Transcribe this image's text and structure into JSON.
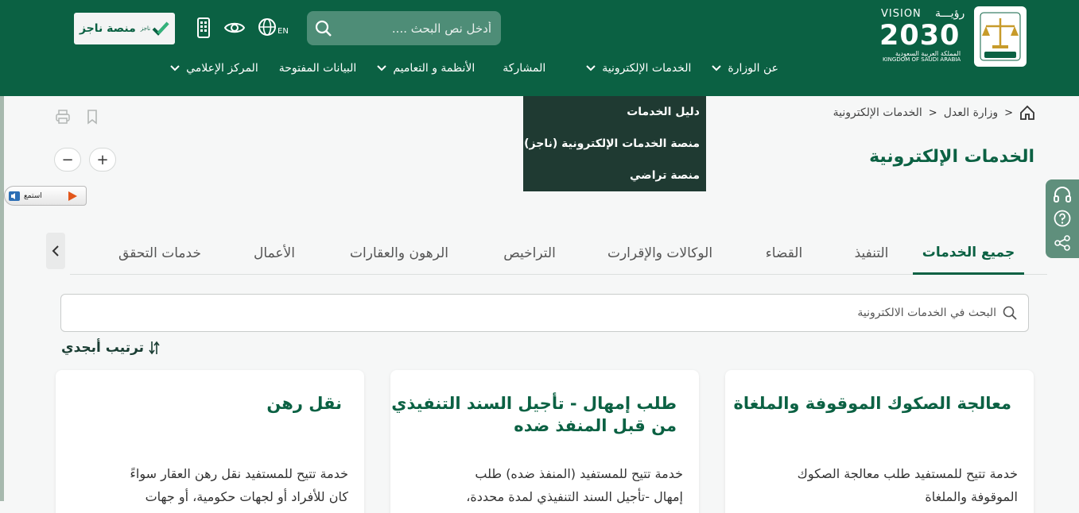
{
  "header": {
    "naiz_label": "منصة ناجز",
    "naiz_logo_small": "ناجز",
    "lang_label": "EN",
    "search_placeholder": "أدخل نص البحث ....",
    "vision": {
      "line1": "VISION",
      "line1_ar": "رؤيـــة",
      "year": "2030",
      "country_ar": "المملكة العربية السعودية",
      "country_en": "KINGDOM OF SAUDI ARABIA"
    },
    "nav": [
      {
        "label": "عن الوزارة",
        "has_chevron": true
      },
      {
        "label": "الخدمات الإلكترونية",
        "has_chevron": true
      },
      {
        "label": "المشاركة",
        "has_chevron": false
      },
      {
        "label": "الأنظمة و التعاميم",
        "has_chevron": true
      },
      {
        "label": "البيانات المفتوحة",
        "has_chevron": false
      },
      {
        "label": "المركز الإعلامي",
        "has_chevron": true
      }
    ],
    "icons": [
      "mobile-icon",
      "eye-icon",
      "globe-icon",
      "search-icon"
    ]
  },
  "dropdown": {
    "items": [
      "دليل الخدمات",
      "منصة الخدمات الإلكترونية (ناجز)",
      "منصة تراضي"
    ]
  },
  "breadcrumb": {
    "items": [
      "وزارة العدل",
      "الخدمات الإلكترونية"
    ]
  },
  "page_title": "الخدمات الإلكترونية",
  "zoom": {
    "plus": "+",
    "minus": "−"
  },
  "listen_label": "استمع",
  "tabs": [
    {
      "label": "جميع الخدمات",
      "active": true
    },
    {
      "label": "التنفيذ",
      "active": false
    },
    {
      "label": "القضاء",
      "active": false
    },
    {
      "label": "الوكالات والإقرارت",
      "active": false
    },
    {
      "label": "التراخيص",
      "active": false
    },
    {
      "label": "الرهون والعقارات",
      "active": false
    },
    {
      "label": "الأعمال",
      "active": false
    },
    {
      "label": "خدمات التحقق",
      "active": false
    }
  ],
  "service_search_placeholder": "البحث في الخدمات الالكترونية",
  "sort_label": "ترتيب أبجدي",
  "cards": [
    {
      "title": "معالجة الصكوك الموقوفة والملغاة",
      "desc_1": "خدمة تتيح للمستفيد طلب معالجة الصكوك",
      "desc_2": "الموقوفة والملغاة"
    },
    {
      "title_1": "طلب إمهال - تأجيل السند التنفيذي",
      "title_2": "من قبل المنفذ ضده",
      "desc_1": "خدمة تتيح للمستفيد (المنفذ ضده) طلب",
      "desc_2": "إمهال -تأجيل السند التنفيذي لمدة محددة،"
    },
    {
      "title": "نقل رهن",
      "desc_1": "خدمة تتيح للمستفيد نقل رهن العقار سواءً",
      "desc_2": "كان للأفراد أو لجهات حكومية، أو جهات"
    }
  ],
  "colors": {
    "brand_green": "#0b6143",
    "dropdown_bg": "#1f3a32",
    "side_panel": "#5f8f7c"
  }
}
